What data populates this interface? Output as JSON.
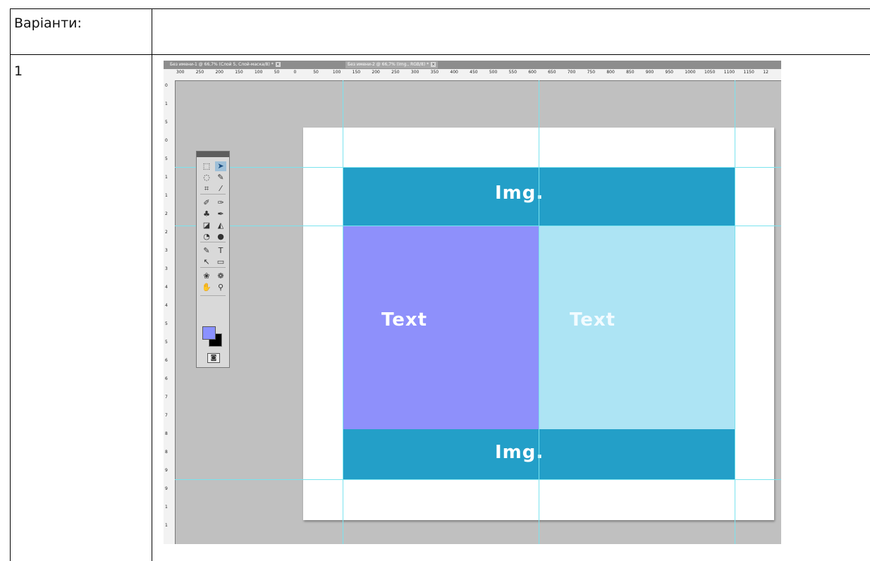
{
  "table": {
    "header_label": "Варіанти:",
    "row1_label": "1"
  },
  "photoshop": {
    "tabs": [
      "Без имени-1 @ 66,7% (Слой 5, Слой-маска/8) *",
      "Без имени-2 @ 66,7% (Img., RGB/8) *"
    ],
    "ruler_h_ticks": [
      "300",
      "250",
      "200",
      "150",
      "100",
      "50",
      "0",
      "50",
      "100",
      "150",
      "200",
      "250",
      "300",
      "350",
      "400",
      "450",
      "500",
      "550",
      "600",
      "650",
      "700",
      "750",
      "800",
      "850",
      "900",
      "950",
      "1000",
      "1050",
      "1100",
      "1150",
      "12"
    ],
    "ruler_v_ticks": [
      "0",
      "1",
      "5",
      "0",
      "5",
      "1",
      "1",
      "2",
      "2",
      "3",
      "3",
      "4",
      "4",
      "5",
      "5",
      "6",
      "6",
      "7",
      "7",
      "8",
      "8",
      "9",
      "9",
      "1",
      "1"
    ],
    "canvas": {
      "top_band_label": "Img.",
      "bottom_band_label": "Img.",
      "left_panel_label": "Text",
      "right_panel_label": "Text"
    },
    "colors": {
      "band": "#239fc8",
      "left_panel": "#8e90fb",
      "right_panel": "#ade4f4",
      "guide": "#7ae3ee",
      "workspace": "#c0c0c0",
      "foreground_swatch": "#8a91ff",
      "background_swatch": "#000000"
    },
    "tools": [
      [
        "marquee-icon",
        "move-icon"
      ],
      [
        "lasso-icon",
        "quick-select-icon"
      ],
      [
        "crop-icon",
        "eyedropper-icon"
      ],
      [
        "healing-brush-icon",
        "brush-icon"
      ],
      [
        "clone-stamp-icon",
        "history-brush-icon"
      ],
      [
        "eraser-icon",
        "paint-bucket-icon"
      ],
      [
        "blur-icon",
        "dodge-icon"
      ],
      [
        "pen-icon",
        "type-icon"
      ],
      [
        "path-select-icon",
        "shape-icon"
      ],
      [
        "3d-rotate-icon",
        "3d-orbit-icon"
      ],
      [
        "hand-icon",
        "zoom-icon"
      ]
    ],
    "tool_glyphs": [
      [
        "⬚",
        "➤"
      ],
      [
        "◌",
        "✎"
      ],
      [
        "⌗",
        "⁄"
      ],
      [
        "✐",
        "✑"
      ],
      [
        "♣",
        "✒"
      ],
      [
        "◪",
        "◭"
      ],
      [
        "◔",
        "●"
      ],
      [
        "✎",
        "T"
      ],
      [
        "↖",
        "▭"
      ],
      [
        "❀",
        "❁"
      ],
      [
        "✋",
        "⚲"
      ]
    ],
    "quick_mask_glyph": "◙"
  }
}
